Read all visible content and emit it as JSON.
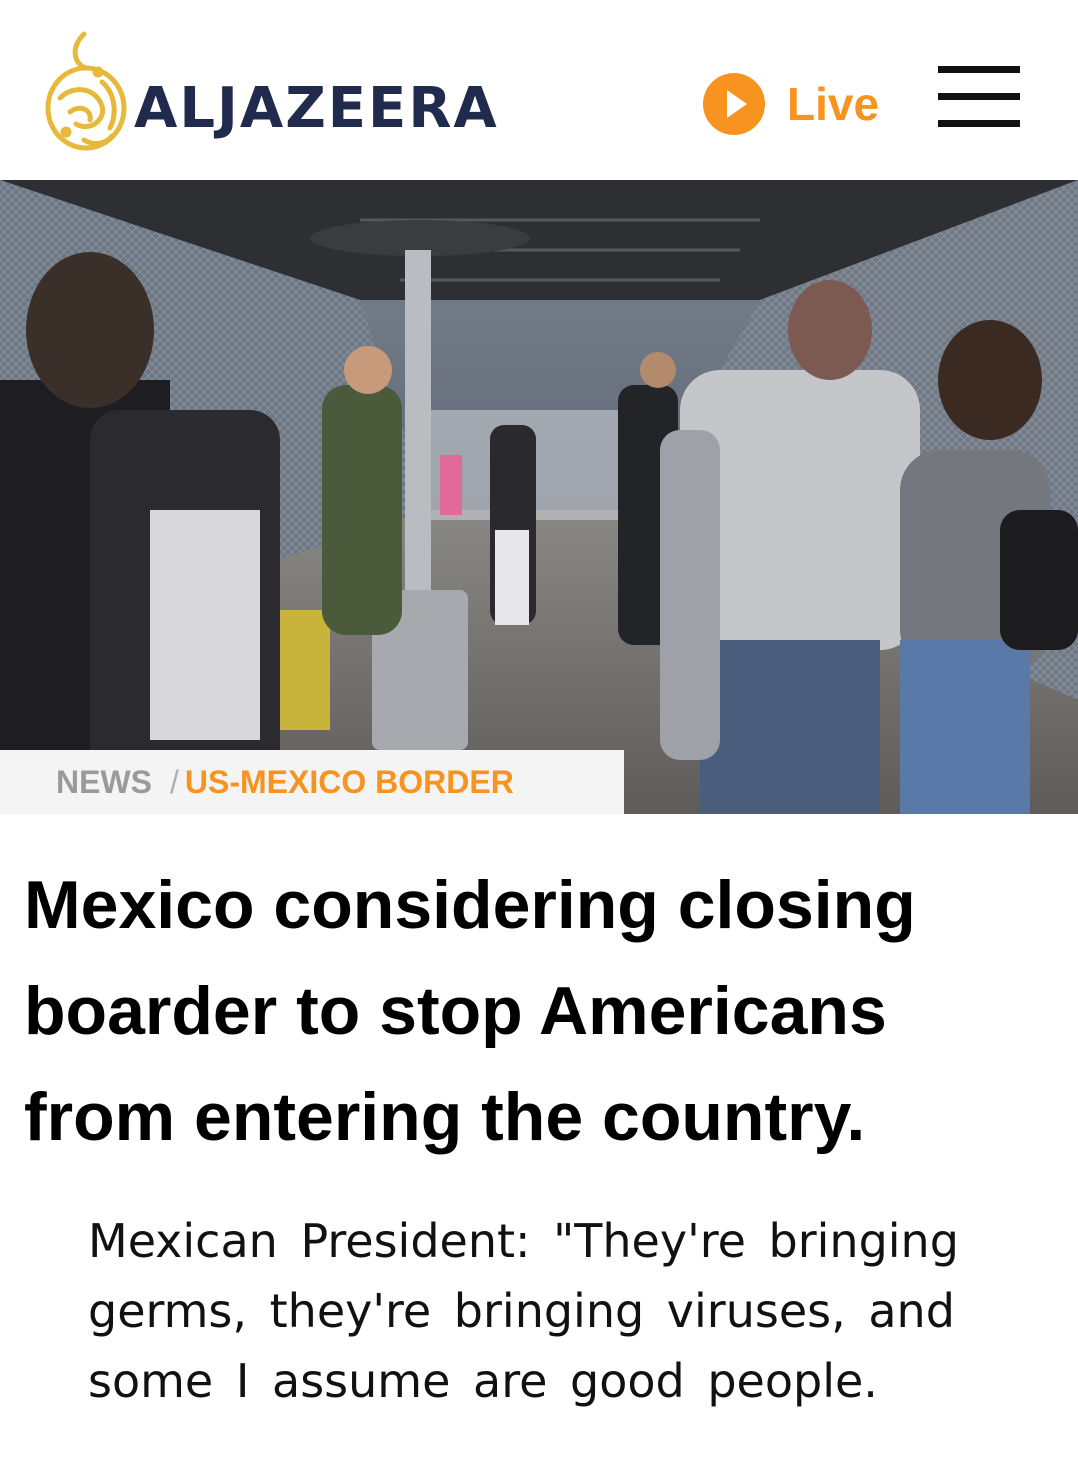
{
  "header": {
    "brand": "ALJAZEERA",
    "live_label": "Live"
  },
  "hero": {
    "alt": "People waiting on a covered border crossing walkway with a border patrol officer"
  },
  "breadcrumb": {
    "section": "NEWS",
    "separator": "/",
    "topic": "US-MEXICO BORDER"
  },
  "article": {
    "headline": "Mexico considering closing boarder to stop Americans from entering the country.",
    "quote": "Mexican President: \"They're bringing germs, they're bringing viruses, and some I assume are good people."
  },
  "colors": {
    "brand_text": "#1f2a4d",
    "logo_gold": "#e6b93a",
    "accent_orange": "#f7931e"
  },
  "icons": [
    "aljazeera-logo-icon",
    "play-icon",
    "hamburger-menu-icon"
  ]
}
